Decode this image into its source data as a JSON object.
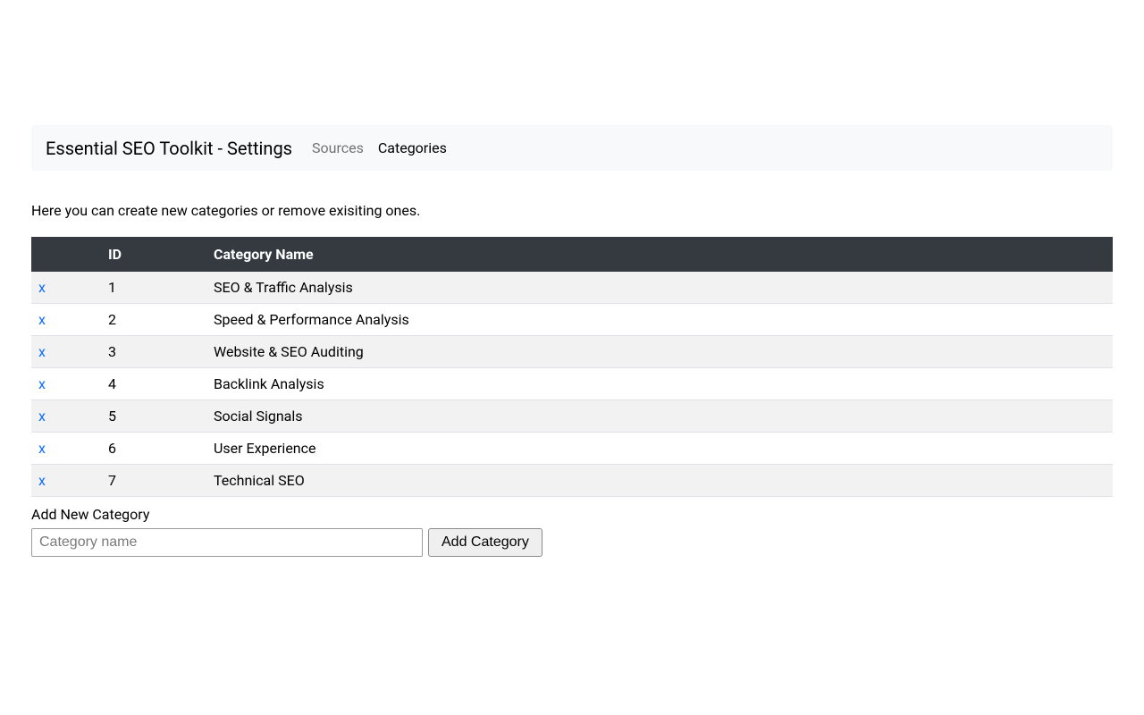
{
  "navbar": {
    "brand": "Essential SEO Toolkit - Settings",
    "links": [
      {
        "label": "Sources",
        "active": false
      },
      {
        "label": "Categories",
        "active": true
      }
    ]
  },
  "description": "Here you can create new categories or remove exisiting ones.",
  "table": {
    "headers": {
      "delete": "",
      "id": "ID",
      "name": "Category Name"
    },
    "rows": [
      {
        "delete": "x",
        "id": "1",
        "name": "SEO & Traffic Analysis"
      },
      {
        "delete": "x",
        "id": "2",
        "name": "Speed & Performance Analysis"
      },
      {
        "delete": "x",
        "id": "3",
        "name": "Website & SEO Auditing"
      },
      {
        "delete": "x",
        "id": "4",
        "name": "Backlink Analysis"
      },
      {
        "delete": "x",
        "id": "5",
        "name": "Social Signals"
      },
      {
        "delete": "x",
        "id": "6",
        "name": "User Experience"
      },
      {
        "delete": "x",
        "id": "7",
        "name": "Technical SEO"
      }
    ]
  },
  "addForm": {
    "label": "Add New Category",
    "placeholder": "Category name",
    "value": "",
    "button": "Add Category"
  }
}
